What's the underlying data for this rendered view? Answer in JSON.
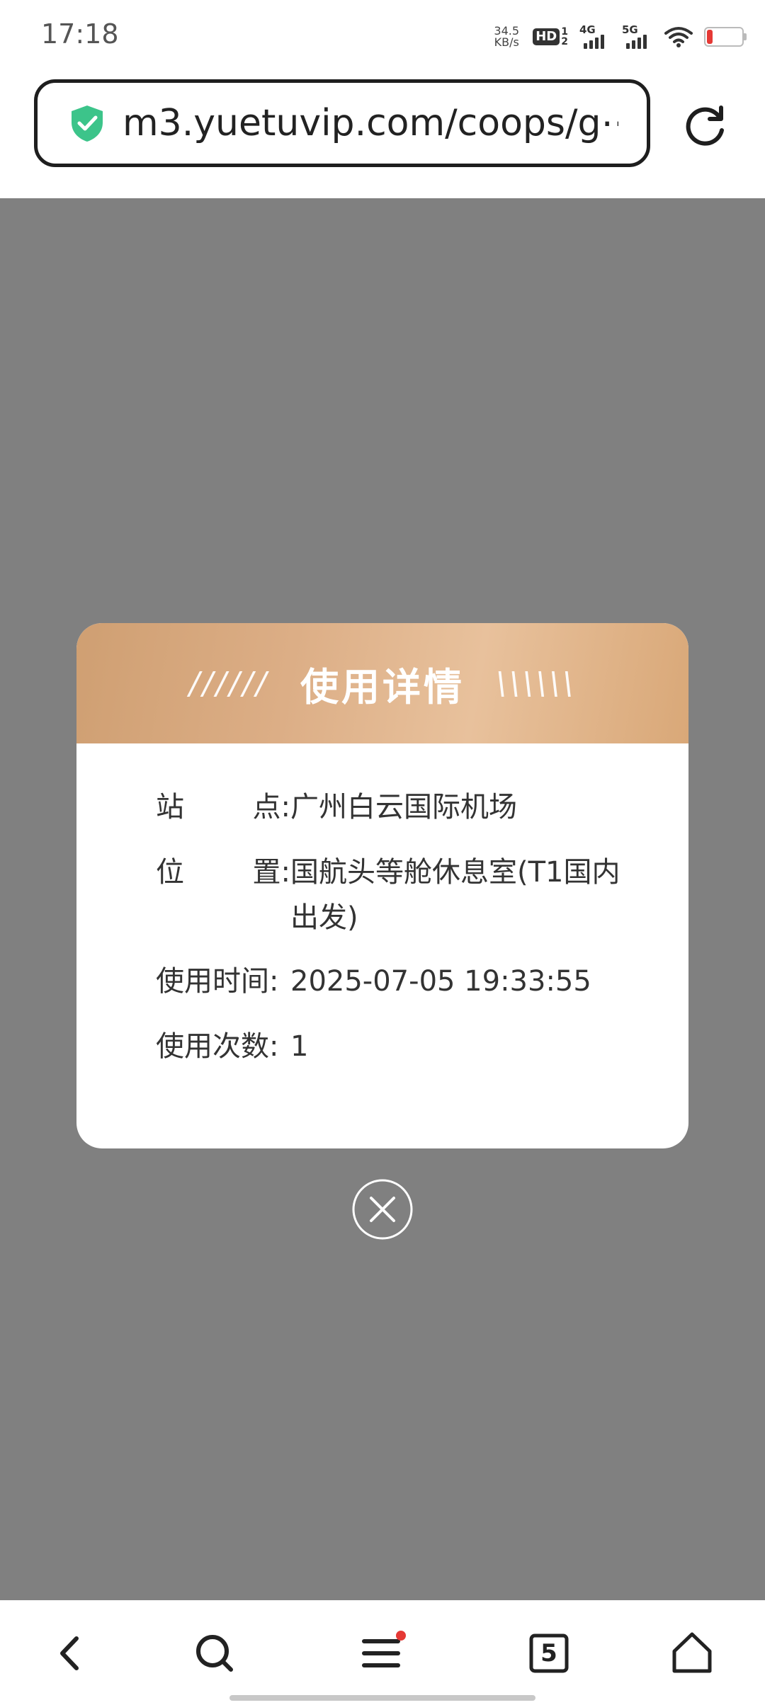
{
  "status_bar": {
    "time": "17:18",
    "net_speed_value": "34.5",
    "net_speed_unit": "KB/s",
    "hd_label": "HD",
    "hd_sub_top": "1",
    "hd_sub_bottom": "2",
    "signal_1_label": "4G",
    "signal_2_label": "5G"
  },
  "browser": {
    "url": "m3.yuetuvip.com/coops/g⋯"
  },
  "modal": {
    "title": "使用详情",
    "deco_left": "//////",
    "deco_right": "\\\\\\\\\\\\",
    "rows": [
      {
        "label_a": "站",
        "label_b": "点:",
        "value": "广州白云国际机场"
      },
      {
        "label_a": "位",
        "label_b": "置:",
        "value": "国航头等舱休息室(T1国内出发)"
      },
      {
        "label_a": "使用时间:",
        "label_b": "",
        "value": "2025-07-05 19:33:55"
      },
      {
        "label_a": "使用次数:",
        "label_b": "",
        "value": "1"
      }
    ]
  },
  "bottom_nav": {
    "tab_count": "5"
  },
  "colors": {
    "overlay": "#808080",
    "header_gold": "#d9a878",
    "shield_green": "#3cc48a",
    "badge_red": "#e53935"
  }
}
